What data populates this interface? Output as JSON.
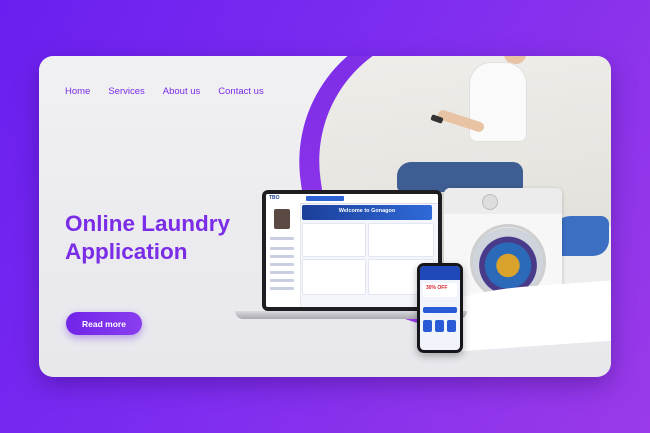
{
  "nav": {
    "items": [
      "Home",
      "Services",
      "About us",
      "Contact us"
    ]
  },
  "hero": {
    "title_line1": "Online Laundry",
    "title_line2": "Application",
    "cta_label": "Read more"
  },
  "laptop_screen": {
    "logo": "TBO",
    "banner": "Welcome to Gonagoo"
  },
  "phone_screen": {
    "promo": "30% OFF"
  },
  "colors": {
    "accent": "#7a2ce6",
    "background_gradient_start": "#6a1ff0",
    "background_gradient_end": "#9a3ae8",
    "card_bg": "#efeff2",
    "app_blue": "#1f48b8"
  }
}
